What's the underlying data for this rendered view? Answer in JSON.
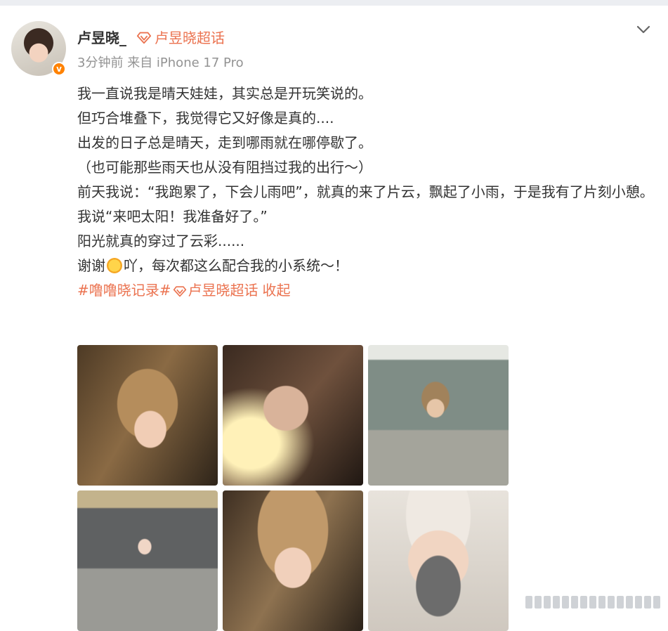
{
  "header": {
    "username": "卢昱晓_",
    "supertopic": "卢昱晓超话",
    "time": "3分钟前",
    "source_prefix": "来自",
    "device": "iPhone 17 Pro"
  },
  "post": {
    "lines": [
      "我一直说我是晴天娃娃，其实总是开玩笑说的。",
      "但巧合堆叠下，我觉得它又好像是真的....",
      "出发的日子总是晴天，走到哪雨就在哪停歇了。",
      "（也可能那些雨天也从没有阻挡过我的出行～）",
      "前天我说：“我跑累了，下会儿雨吧”，就真的来了片云，飘起了小雨，于是我有了片刻小憩。",
      "我说“来吧太阳！我准备好了。”",
      "阳光就真的穿过了云彩......"
    ],
    "last_line_before": "谢谢",
    "last_line_after": "吖，每次都这么配合我的小系统～！",
    "tags": {
      "tag1": "#噜噜晓记录#",
      "tag2": "卢昱晓超话",
      "collapse": "收起"
    }
  },
  "photos": [
    {
      "label": "photo-1"
    },
    {
      "label": "photo-2"
    },
    {
      "label": "photo-3"
    },
    {
      "label": "photo-4"
    },
    {
      "label": "photo-5"
    },
    {
      "label": "photo-6"
    }
  ],
  "icons": {
    "verified": "verified-badge-icon",
    "supertopic": "diamond-icon",
    "menu": "chevron-down-icon",
    "emoji": "sun-emoji-icon"
  },
  "colors": {
    "accent": "#eb7350",
    "meta": "#939393",
    "text": "#333333",
    "verified": "#ff8200"
  }
}
